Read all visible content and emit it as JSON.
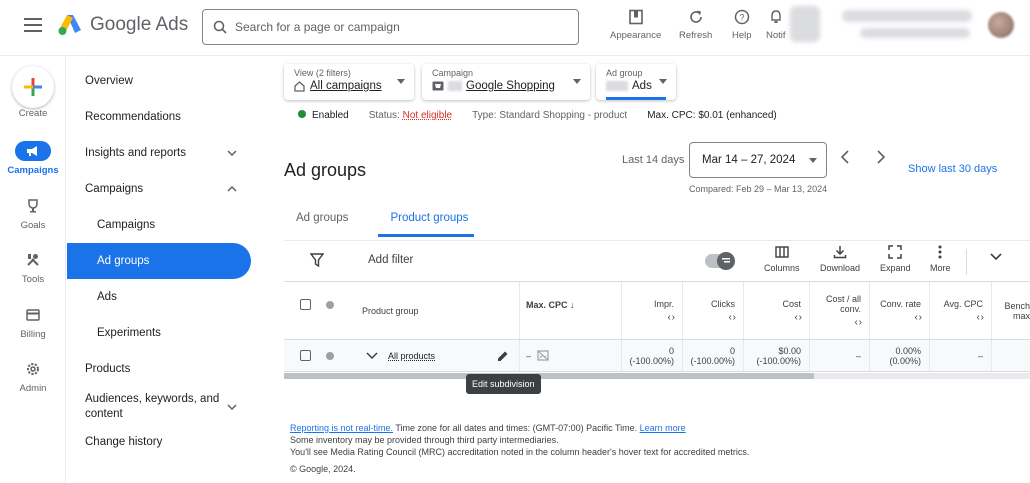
{
  "header": {
    "brand": "Google Ads",
    "search_placeholder": "Search for a page or campaign",
    "buttons": [
      {
        "label": "Appearance",
        "icon": "appearance-icon"
      },
      {
        "label": "Refresh",
        "icon": "refresh-icon"
      },
      {
        "label": "Help",
        "icon": "help-icon"
      },
      {
        "label": "Notif",
        "icon": "notifications-icon"
      }
    ]
  },
  "rail": {
    "create": "Create",
    "items": [
      {
        "label": "Campaigns",
        "icon": "campaigns-icon"
      },
      {
        "label": "Goals",
        "icon": "goals-icon"
      },
      {
        "label": "Tools",
        "icon": "tools-icon"
      },
      {
        "label": "Billing",
        "icon": "billing-icon"
      },
      {
        "label": "Admin",
        "icon": "admin-icon"
      }
    ]
  },
  "nav": {
    "items": [
      {
        "label": "Overview"
      },
      {
        "label": "Recommendations"
      },
      {
        "label": "Insights and reports",
        "chevron": "down"
      },
      {
        "label": "Campaigns",
        "chevron": "up"
      },
      {
        "label": "Campaigns",
        "sub": true
      },
      {
        "label": "Ad groups",
        "sub": true,
        "active": true
      },
      {
        "label": "Ads",
        "sub": true
      },
      {
        "label": "Experiments",
        "sub": true
      },
      {
        "label": "Products"
      },
      {
        "label": "Audiences, keywords, and content",
        "chevron": "down"
      },
      {
        "label": "Change history"
      }
    ]
  },
  "filters": {
    "view_label": "View (2 filters)",
    "view_value": "All campaigns",
    "campaign_label": "Campaign",
    "campaign_value": "Google Shopping",
    "adgroup_label": "Ad group",
    "adgroup_value": "Ads"
  },
  "status": {
    "enabled": "Enabled",
    "status_label": "Status:",
    "status_value": "Not eligible",
    "type": "Type: Standard Shopping - product",
    "max_cpc": "Max. CPC: $0.01 (enhanced)"
  },
  "page": {
    "title": "Ad groups",
    "date_label": "Last 14 days",
    "date_range": "Mar 14 – 27, 2024",
    "compared": "Compared: Feb 29 – Mar 13, 2024",
    "show_last": "Show last 30 days"
  },
  "tabs": [
    "Ad groups",
    "Product groups"
  ],
  "toolbar": {
    "add_filter": "Add filter",
    "columns": "Columns",
    "download": "Download",
    "expand": "Expand",
    "more": "More"
  },
  "table": {
    "headers": {
      "product_group": "Product group",
      "max_cpc": "Max. CPC",
      "impr": "Impr.",
      "clicks": "Clicks",
      "cost": "Cost",
      "cost_all_conv": "Cost / all conv.",
      "conv_rate": "Conv. rate",
      "avg_cpc": "Avg. CPC",
      "bench": "Bench max"
    },
    "row": {
      "name": "All products",
      "max_cpc": "–",
      "impr": "0",
      "impr_change": "(-100.00%)",
      "clicks": "0",
      "clicks_change": "(-100.00%)",
      "cost": "$0.00",
      "cost_change": "(-100.00%)",
      "cost_all_conv": "–",
      "conv_rate": "0.00%",
      "conv_rate_change": "(0.00%)",
      "avg_cpc": "–"
    }
  },
  "tooltip": "Edit subdivision",
  "footer": {
    "line1_link": "Reporting is not real-time.",
    "line1_text": " Time zone for all dates and times: (GMT-07:00) Pacific Time. ",
    "line1_link2": "Learn more",
    "line2": "Some inventory may be provided through third party intermediaries.",
    "line3": "You'll see Media Rating Council (MRC) accreditation noted in the column header's hover text for accredited metrics.",
    "copyright": "© Google, 2024."
  }
}
